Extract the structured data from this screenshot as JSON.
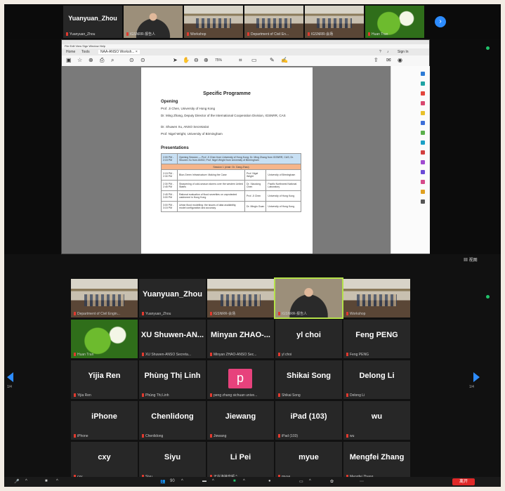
{
  "top_strip": {
    "tiles": [
      {
        "big": "Yuanyuan_Zhou",
        "name": "Yuanyuan_Zhou"
      },
      {
        "big": "",
        "name": "IGSNRR-报告人"
      },
      {
        "big": "",
        "name": "Workshop"
      },
      {
        "big": "",
        "name": "Department of Civil En..."
      },
      {
        "big": "",
        "name": "IGSNRR-会场"
      },
      {
        "big": "",
        "name": "Huan Tran"
      }
    ],
    "next_arrow": "›"
  },
  "window": {
    "title": "",
    "menu": "File  Edit  View  Sign  Window  Help",
    "tabs": [
      "Home",
      "Tools",
      "NAA-ANSO Worksh... ×"
    ],
    "signin": "Sign In",
    "zoom": "75%"
  },
  "document": {
    "heading": "Specific Programme",
    "opening_label": "Opening",
    "opening_lines": [
      "Prof. Ji Chen, University of Hong Kong",
      "Dr. Ming Zhang, Deputy Director of the International Cooperation Division, IGSNRR, CAS",
      "Dr. Shuwen Xu, ANSO Secretariat",
      "Prof. Nigel Wright, University of Birmingham"
    ],
    "presentations_label": "Presentations",
    "table_rows": [
      [
        "2:00 PM - 2:15 PM",
        "Opening Session — Prof. Ji Chen from University of Hong Kong; Dr. Ming Zhang from IGSNRR, CAS; Dr. Shuwen Xu from ANSO; Prof. Nigel Wright from University of Birmingham",
        "",
        ""
      ],
      [
        "",
        "Session 1 (chair: Dr. Gang Zhao)",
        "",
        ""
      ],
      [
        "2:15 PM - 2:30 PM",
        "Blue-Green Infrastructure: Making the Case",
        "Prof. Nigel Wright",
        "University of Birmingham"
      ],
      [
        "2:30 PM - 2:45 PM",
        "Sharpening of cold-season storms over the western United States",
        "Dr. Xiaodong Chen",
        "Pacific Northwest National Laboratory"
      ],
      [
        "2:45 PM - 3:00 PM",
        "Rational evaluation of flood severities on unprotected catchment in Hong Kong",
        "Prof. Ji Chen",
        "University of Hong Kong"
      ],
      [
        "3:00 PM - 3:15 PM",
        "Urban flood modelling: the issues of data availability, model configuration and accuracy",
        "Dr. Minglu Guan",
        "University of Hong Kong"
      ]
    ]
  },
  "gallery": {
    "view_label": "视图",
    "page_left": "1/4",
    "page_right": "1/4",
    "tiles": [
      {
        "big": "",
        "name": "Department of Civil Engin...",
        "kind": "room"
      },
      {
        "big": "Yuanyuan_Zhou",
        "name": "Yuanyuan_Zhou",
        "kind": "text"
      },
      {
        "big": "",
        "name": "IGSNRR-会场",
        "kind": "room"
      },
      {
        "big": "",
        "name": "IGSNRR-报告人",
        "kind": "person"
      },
      {
        "big": "",
        "name": "Workshop",
        "kind": "room"
      },
      {
        "big": "",
        "name": "Huan Tran",
        "kind": "plant"
      },
      {
        "big": "XU Shuwen-AN...",
        "name": "XU Shuwen-ANSO Secreta...",
        "kind": "text"
      },
      {
        "big": "Minyan ZHAO-...",
        "name": "Minyan ZHAO-ANSO Sec...",
        "kind": "text"
      },
      {
        "big": "yl choi",
        "name": "yl choi",
        "kind": "text"
      },
      {
        "big": "Feng PENG",
        "name": "Feng PENG",
        "kind": "text"
      },
      {
        "big": "Yijia Ren",
        "name": "Yijia Ren",
        "kind": "text"
      },
      {
        "big": "Phùng Thị Linh",
        "name": "Phùng Thị Linh",
        "kind": "text"
      },
      {
        "big": "p",
        "name": "peng zhang sichuan unive...",
        "kind": "avatar"
      },
      {
        "big": "Shikai Song",
        "name": "Shikai Song",
        "kind": "text"
      },
      {
        "big": "Delong Li",
        "name": "Delong Li",
        "kind": "text"
      },
      {
        "big": "iPhone",
        "name": "iPhone",
        "kind": "text"
      },
      {
        "big": "Chenlidong",
        "name": "Chenlidong",
        "kind": "text"
      },
      {
        "big": "Jiewang",
        "name": "Jiewang",
        "kind": "text"
      },
      {
        "big": "iPad (103)",
        "name": "iPad (103)",
        "kind": "text"
      },
      {
        "big": "wu",
        "name": "wu",
        "kind": "text"
      },
      {
        "big": "cxy",
        "name": "cxy",
        "kind": "text"
      },
      {
        "big": "Siyu",
        "name": "Siyu",
        "kind": "text"
      },
      {
        "big": "Li Pei",
        "name": "正在连接音频 ^",
        "kind": "text"
      },
      {
        "big": "myue",
        "name": "myue",
        "kind": "text"
      },
      {
        "big": "Mengfei Zhang",
        "name": "Mengfei Zhang",
        "kind": "text"
      }
    ]
  },
  "bottom_bar": {
    "participants_count": "90",
    "leave_label": "离开"
  },
  "colors": {
    "accent": "#2d8cff",
    "active_border": "#b5e24a",
    "leave": "#e02828"
  }
}
